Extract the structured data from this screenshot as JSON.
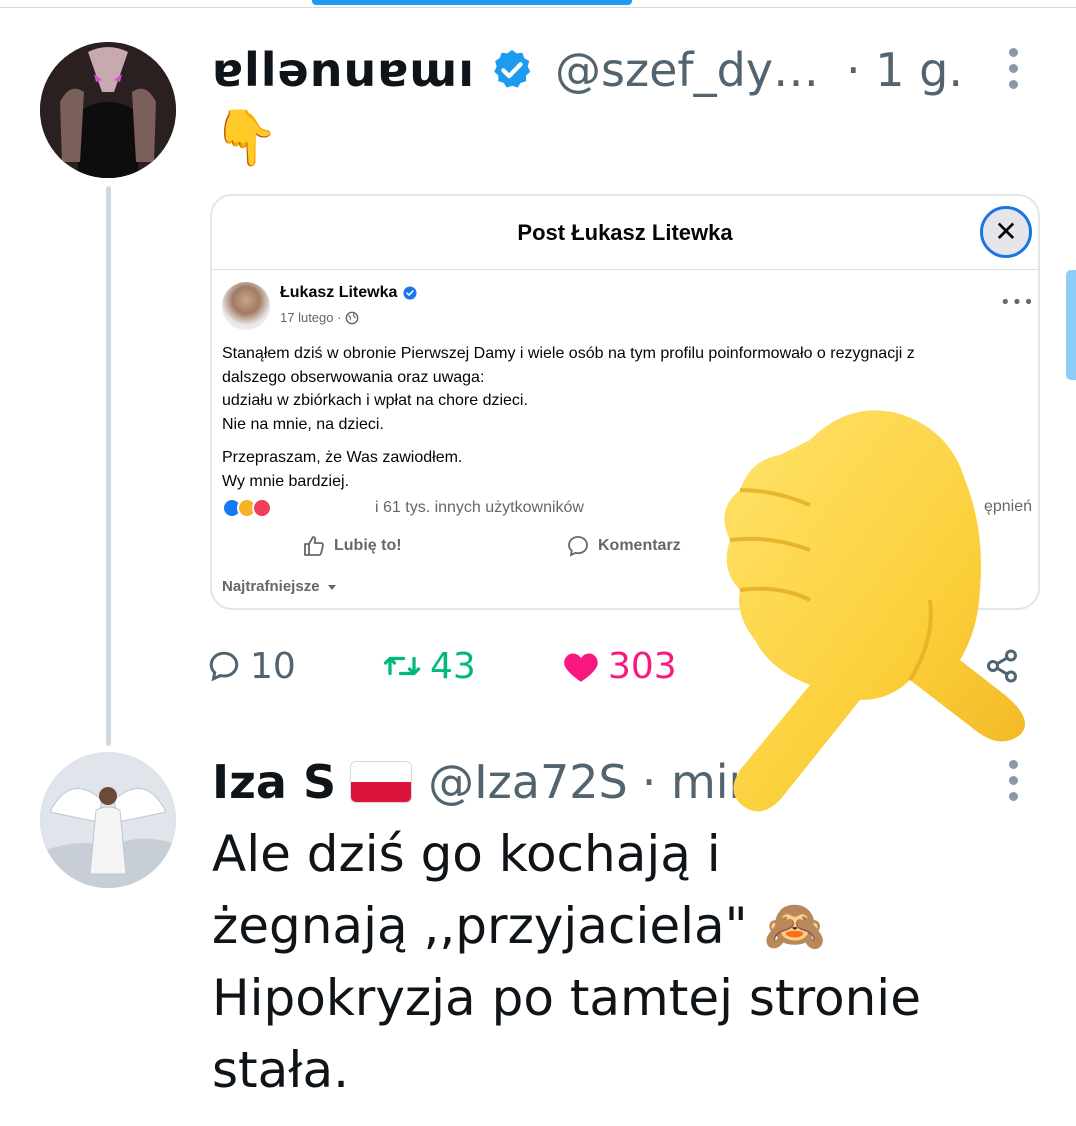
{
  "thread": {
    "tweet1": {
      "display_name": "ɐllǝnuɐɯı",
      "handle": "@szef_dy…",
      "time": "· 1 g.",
      "text": "👇",
      "more_icon": "more-vertical-icon",
      "verified_icon": "verified-badge-icon",
      "actions": {
        "reply_count": "10",
        "retweet_count": "43",
        "like_count": "303"
      }
    },
    "tweet2": {
      "display_name": "Iza S",
      "flag": "🇵🇱",
      "handle": "@Iza72S",
      "time": "· min",
      "text_line1": "Ale dziś go kochają i",
      "text_line2": "żegnają ,,przyjaciela\" 🙈",
      "text_line3": "Hipokryzja po tamtej stronie",
      "text_line4": "stała.",
      "more_icon": "more-vertical-icon"
    }
  },
  "embedded_post": {
    "title": "Post Łukasz Litewka",
    "close_label": "✕",
    "author": "Łukasz Litewka",
    "date": "17 lutego ·",
    "body_lines": [
      "Stanąłem dziś w obronie Pierwszej Damy i wiele osób na tym profilu poinformowało o rezygnacji z",
      "dalszego obserwowania oraz uwaga:",
      "udziału w zbiórkach i wpłat na chore dzieci.",
      "Nie na mnie, na dzieci."
    ],
    "body_lines_2": [
      "Przepraszam, że Was zawiodłem.",
      "Wy mnie bardziej."
    ],
    "reactions_text": "i 61 tys. innych użytkowników",
    "shares_text": "ępnień",
    "like_action": "Lubię to!",
    "comment_action": "Komentarz",
    "sort_label": "Najtrafniejsze"
  },
  "colors": {
    "accent": "#1d9bf0",
    "retweet": "#00ba7c",
    "like": "#f91880",
    "secondary_text": "#536471",
    "fb_blue": "#1877f2"
  }
}
